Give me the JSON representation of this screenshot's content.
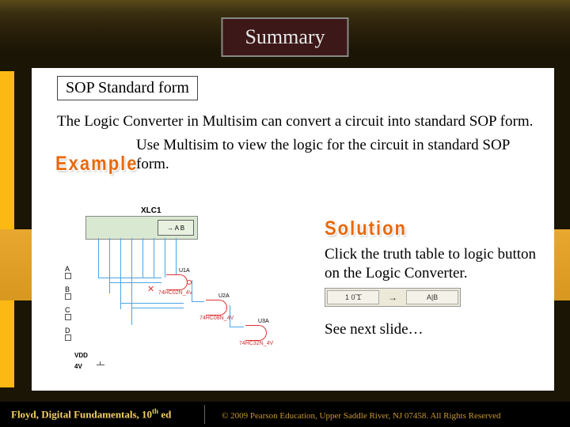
{
  "title": "Summary",
  "section_label": "SOP Standard form",
  "intro_text": "The Logic Converter in Multisim can convert a circuit into standard SOP form.",
  "example_prompt": "Use Multisim to view the logic for the circuit in standard SOP form.",
  "example_label": "Example",
  "solution_label": "Solution",
  "hint_text": "Click the truth table to logic button on the Logic Converter.",
  "see_next": "See next slide…",
  "converter": {
    "id": "XLC1",
    "output": "→ A B"
  },
  "signals": [
    "A",
    "B",
    "C",
    "D"
  ],
  "gates": [
    {
      "id": "U1A",
      "chip": "74HC02N_4V"
    },
    {
      "id": "U2A",
      "chip": "74HC08N_4V"
    },
    {
      "id": "U3A",
      "chip": "74HC32N_4V"
    }
  ],
  "power": {
    "vdd": "VDD",
    "volt": "4V"
  },
  "buttons": {
    "left": "1 0 ͞1",
    "right": "A|B"
  },
  "footer_left": "Floyd, Digital Fundamentals, 10",
  "footer_left_sup": "th",
  "footer_left_tail": " ed",
  "footer_right": "© 2009 Pearson Education, Upper Saddle River, NJ 07458. All Rights Reserved"
}
